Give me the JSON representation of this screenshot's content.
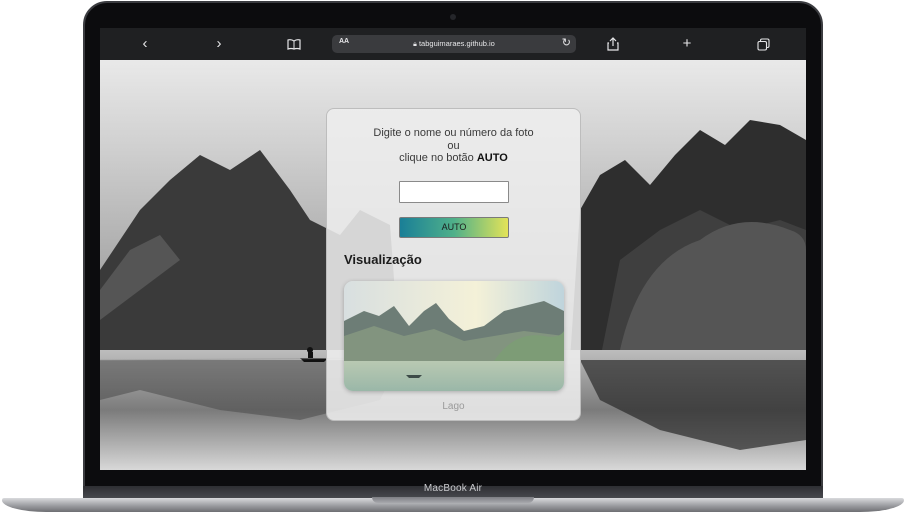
{
  "device": {
    "label": "MacBook Air"
  },
  "browser": {
    "reader_label": "AA",
    "url": "tabguimaraes.github.io",
    "icons": {
      "back": "chevron-left-icon",
      "forward": "chevron-right-icon",
      "bookmarks": "book-icon",
      "lock": "lock-icon",
      "reload": "reload-icon",
      "share": "share-icon",
      "new_tab": "plus-icon",
      "tabs": "tabs-icon"
    }
  },
  "form": {
    "instruction_line1": "Digite o nome ou número da foto",
    "instruction_line2": "ou",
    "instruction_line3_prefix": "clique no botão ",
    "instruction_line3_bold": "AUTO",
    "input_value": "",
    "auto_button_label": "AUTO"
  },
  "preview": {
    "heading": "Visualização",
    "caption": "Lago"
  },
  "colors": {
    "auto_gradient_start": "#1a7f97",
    "auto_gradient_end": "#e3e358",
    "card_background": "#eeeeee",
    "toolbar_background": "#1f2022"
  }
}
